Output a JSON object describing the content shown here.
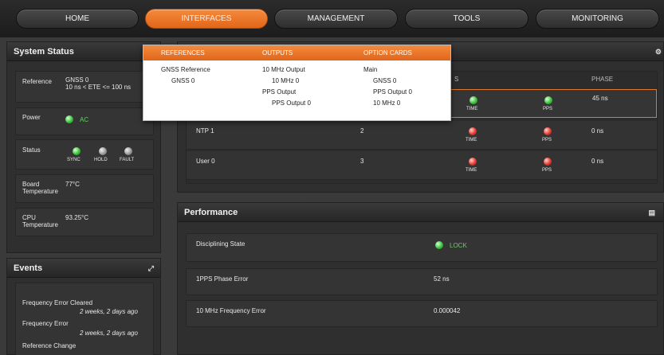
{
  "nav": {
    "items": [
      {
        "label": "HOME"
      },
      {
        "label": "INTERFACES"
      },
      {
        "label": "MANAGEMENT"
      },
      {
        "label": "TOOLS"
      },
      {
        "label": "MONITORING"
      }
    ],
    "active_color": "#f07a2a"
  },
  "system_status": {
    "title": "System Status",
    "reference": {
      "label": "Reference",
      "value1": "GNSS 0",
      "value2": "10 ns < ETE <= 100 ns"
    },
    "power": {
      "label": "Power",
      "value": "AC"
    },
    "status": {
      "label": "Status",
      "sync": "SYNC",
      "hold": "HOLD",
      "fault": "FAULT"
    },
    "board_temp": {
      "label1": "Board",
      "label2": "Temperature",
      "value": "77°C"
    },
    "cpu_temp": {
      "label1": "CPU",
      "label2": "Temperature",
      "value": "93.25°C"
    }
  },
  "events": {
    "title": "Events",
    "items": [
      {
        "text": "Frequency Error Cleared",
        "time": "2 weeks, 2 days ago"
      },
      {
        "text": "Frequency Error",
        "time": "2 weeks, 2 days ago"
      },
      {
        "text": "Reference Change"
      }
    ]
  },
  "references_table": {
    "col_s": "S",
    "col_phase": "PHASE",
    "rows": [
      {
        "name": "",
        "priority": "",
        "time_label": "TIME",
        "pps_label": "PPS",
        "phase": "45 ns"
      },
      {
        "name": "NTP 1",
        "priority": "2",
        "time_label": "TIME",
        "pps_label": "PPS",
        "phase": "0 ns"
      },
      {
        "name": "User 0",
        "priority": "3",
        "time_label": "TIME",
        "pps_label": "PPS",
        "phase": "0 ns"
      }
    ]
  },
  "performance": {
    "title": "Performance",
    "rows": [
      {
        "label": "Disciplining State",
        "value": "LOCK"
      },
      {
        "label": "1PPS Phase Error",
        "value": "52 ns"
      },
      {
        "label": "10 MHz Frequency Error",
        "value": "0.000042"
      }
    ]
  },
  "dropdown": {
    "references": {
      "header": "REFERENCES",
      "items": [
        "GNSS Reference",
        "GNSS 0"
      ]
    },
    "outputs": {
      "header": "OUTPUTS",
      "items": [
        "10 MHz Output",
        "10 MHz 0",
        "PPS Output",
        "PPS Output 0"
      ]
    },
    "option_cards": {
      "header": "OPTION CARDS",
      "items": [
        "Main",
        "GNSS 0",
        "PPS Output 0",
        "10 MHz 0"
      ]
    }
  },
  "icons": {
    "expand": "expand-icon",
    "chart": "chart-icon",
    "gear": "gear-icon"
  }
}
